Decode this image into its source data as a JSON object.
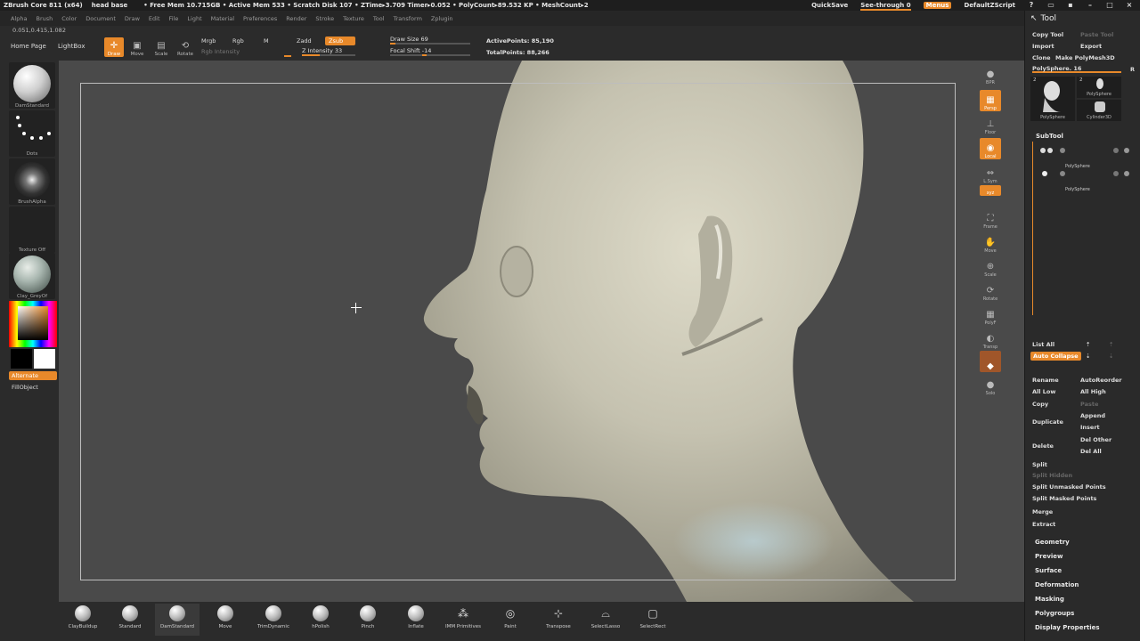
{
  "titlebar": {
    "app": "ZBrush Core 811 (x64)",
    "doc": "head base",
    "stats": "• Free Mem 10.715GB • Active Mem 533 • Scratch Disk 107 • ZTime▸3.709 Timer▸0.052 • PolyCount▸89.532 KP • MeshCount▸2",
    "quicksave": "QuickSave",
    "seethrough": "See-through  0",
    "menus": "Menus",
    "script": "DefaultZScript"
  },
  "menubar": [
    "Alpha",
    "Brush",
    "Color",
    "Document",
    "Draw",
    "Edit",
    "File",
    "Light",
    "Material",
    "Preferences",
    "Render",
    "Stroke",
    "Texture",
    "Tool",
    "Transform",
    "Zplugin"
  ],
  "coords": "0.051,0.415,1.082",
  "toolbar": {
    "homepage": "Home Page",
    "lightbox": "LightBox",
    "draw": "Draw",
    "move": "Move",
    "scale": "Scale",
    "rotate": "Rotate",
    "mrgb": "Mrgb",
    "rgb": "Rgb",
    "m": "M",
    "rgb_intensity": "Rgb Intensity",
    "zadd": "Zadd",
    "zsub": "Zsub",
    "z_intensity": "Z Intensity 33",
    "z_intensity_value": 33,
    "draw_size": "Draw Size 69",
    "draw_size_value": 69,
    "focal_shift": "Focal Shift -14",
    "focal_shift_value": -14,
    "active_points": "ActivePoints: 85,190",
    "total_points": "TotalPoints: 88,266"
  },
  "leftshelf": {
    "brush": "DamStandard",
    "stroke": "Dots",
    "alpha": "BrushAlpha",
    "texture": "Texture Off",
    "material": "Clay_GreyOf",
    "alternate": "Alternate",
    "fillobject": "FillObject"
  },
  "rightshelf": [
    "BPR",
    "Persp",
    "Floor",
    "Local",
    "L.Sym",
    "xyz",
    "Frame",
    "Move",
    "Scale",
    "Rotate",
    "PolyF",
    "Transp",
    "Solo"
  ],
  "toolpanel": {
    "title": "Tool",
    "copy_tool": "Copy Tool",
    "paste_tool": "Paste Tool",
    "import": "Import",
    "export": "Export",
    "clone": "Clone",
    "make_polymesh": "Make PolyMesh3D",
    "polysphere": "PolySphere. 16",
    "r": "R",
    "thumb1_count": "2",
    "thumb1_label": "PolySphere",
    "thumb2_count": "2",
    "thumb2_label": "PolySphere",
    "thumb3_label": "Cylinder3D",
    "subtool": "SubTool",
    "subtool_items": [
      "PolySphere",
      "PolySphere"
    ],
    "list_all": "List All",
    "auto_collapse": "Auto Collapse",
    "rename": "Rename",
    "autoreorder": "AutoReorder",
    "all_low": "All Low",
    "all_high": "All High",
    "copy": "Copy",
    "paste": "Paste",
    "duplicate": "Duplicate",
    "append": "Append",
    "insert": "Insert",
    "delete": "Delete",
    "del_other": "Del Other",
    "del_all": "Del All",
    "split": "Split",
    "split_hidden": "Split Hidden",
    "split_unmasked": "Split Unmasked Points",
    "split_masked": "Split Masked Points",
    "merge": "Merge",
    "extract": "Extract",
    "sections": [
      "Geometry",
      "Preview",
      "Surface",
      "Deformation",
      "Masking",
      "Polygroups",
      "Display Properties"
    ]
  },
  "bottomshelf": [
    "ClayBuildup",
    "Standard",
    "DamStandard",
    "Move",
    "TrimDynamic",
    "hPolish",
    "Pinch",
    "Inflate",
    "IMM Primitives",
    "Paint",
    "Transpose",
    "SelectLasso",
    "SelectRect"
  ],
  "colors": {
    "accent": "#e8892a",
    "canvas": "#4a4a4a",
    "panel": "#2a2a2a",
    "skin": "#c9c6b6"
  }
}
